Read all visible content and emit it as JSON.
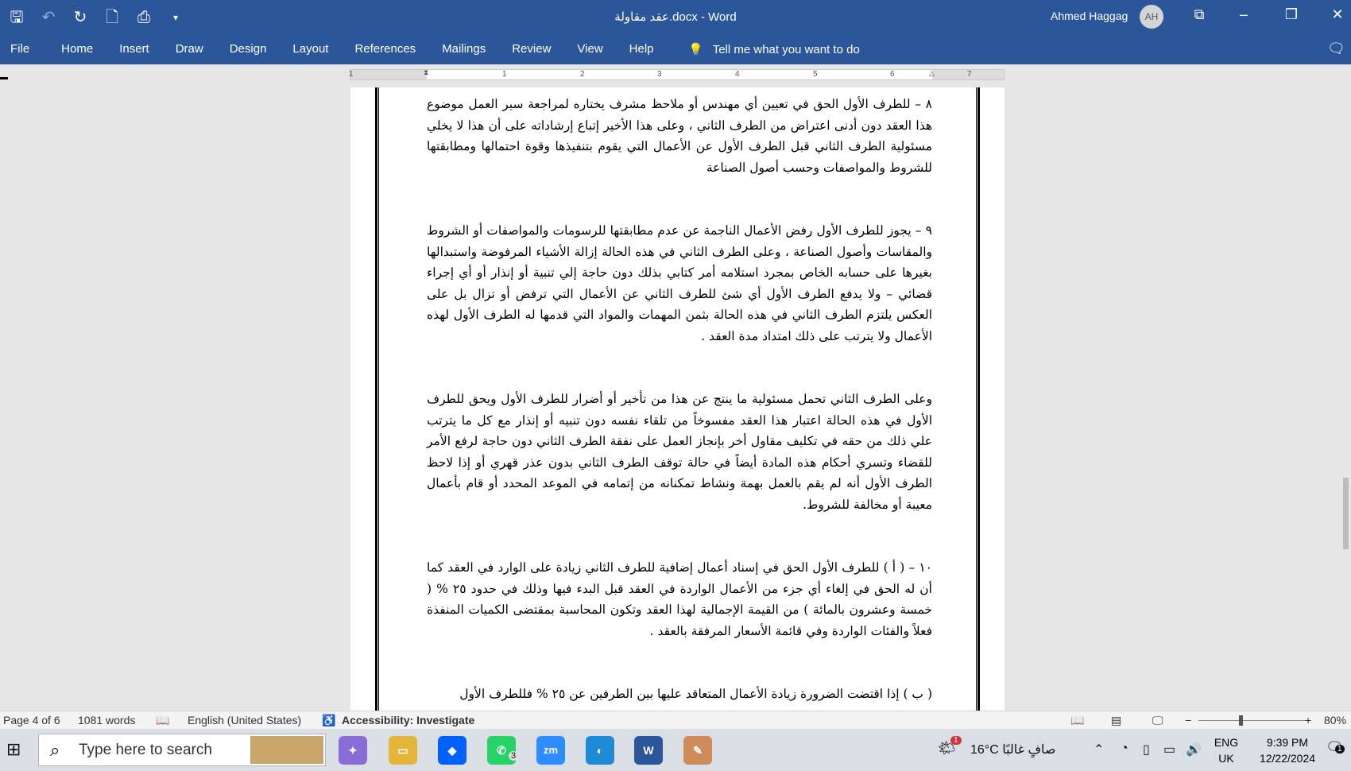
{
  "window": {
    "title": "عقد مقاولة.docx  -  Word",
    "user_name": "Ahmed Haggag",
    "user_initials": "AH"
  },
  "ribbon": {
    "tabs": [
      "File",
      "Home",
      "Insert",
      "Draw",
      "Design",
      "Layout",
      "References",
      "Mailings",
      "Review",
      "View",
      "Help"
    ],
    "tell_me": "Tell me what you want to do"
  },
  "ruler": {
    "numbers": [
      "1",
      "1",
      "2",
      "3",
      "4",
      "5",
      "6",
      "7"
    ]
  },
  "document": {
    "paragraphs": [
      "٨ – للطرف الأول الحق في تعيين أي مهندس أو ملاحظ مشرف يختاره لمراجعة سير العمل موضوع هذا العقد دون أدنى اعتراض من الطرف الثاني ، وعلى هذا الأخير إتباع إرشاداته على أن هذا  لا يخلي مسئولية الطرف الثاني قبل الطرف الأول عن الأعمال التي يقوم بتنفيذها وقوة احتمالها ومطابقتها للشروط والمواصفات وحسب أصول الصناعة",
      "٩ – يجوز للطرف الأول رفض الأعمال الناجمة عن عدم مطابقتها للرسومات والمواصفات أو الشروط والمقاسات وأصول الصناعة ، وعلى الطرف الثاني في هذه الحالة إزالة الأشياء المرفوضة واستبدالها بغيرها على حسابه الخاص بمجرد استلامه أمر كتابي بذلك دون حاجة إلي تنبية أو إنذار أو أي إجراء قضائي – ولا يدفع الطرف الأول أي شئ للطرف الثاني عن الأعمال التي ترفض أو تزال بل على العكس يلتزم الطرف الثاني في هذه الحالة بثمن المهمات والمواد التي قدمها له الطرف الأول لهذه الأعمال ولا يترتب على ذلك امتداد مدة العقد .",
      "وعلى الطرف الثاني تحمل مسئولية ما ينتج عن هذا من تأخير أو أضرار للطرف الأول ويحق للطرف الأول في هذه الحالة اعتبار هذا العقد مفسوخاً من تلقاء نفسه دون تنبيه أو إنذار مع كل ما يترتب علي ذلك من حقه في تكليف مقاول أخر بإنجاز العمل على نفقة الطرف الثاني دون حاجة لرفع الأمر للقضاء وتسري أحكام هذه المادة أيضاً في حالة توقف الطرف الثاني بدون عذر قهري أو إذا لاحظ الطرف الأول أنه لم يقم بالعمل بهمة ونشاط تمكنانه من إتمامه في الموعد المحدد أو قام بأعمال معيبة أو مخالفة للشروط.",
      "١٠ – ( أ ) للطرف الأول الحق في إسناد أعمال إضافية للطرف الثاني زيادة على الوارد في العقد كما أن له الحق في إلغاء أي جزء من الأعمال الواردة في العقد قبل البدء فيها وذلك في حدود ٢٥ % ( خمسة وعشرون بالمائة ) من القيمة الإجمالية لهذا العقد وتكون المحاسبة بمقتضى الكميات المنفذة فعلاً والفئات الواردة وفي قائمة الأسعار المرفقة بالعقد .",
      "( ب )  إذا اقتضت الضرورة زيادة الأعمال المتعاقد عليها بين الطرفين عن ٢٥ % فللطرف الأول"
    ]
  },
  "status": {
    "page": "Page 4 of 6",
    "words": "1081 words",
    "language": "English (United States)",
    "accessibility": "Accessibility: Investigate",
    "zoom": "80%",
    "zoom_level": 0.8
  },
  "taskbar": {
    "search_placeholder": "Type here to search",
    "weather": "16°C  صافٍ غالبًا",
    "lang_top": "ENG",
    "lang_bottom": "UK",
    "time": "9:39 PM",
    "date": "12/22/2024",
    "whatsapp_count": "3",
    "notification_count": "1",
    "weather_badge": "1"
  },
  "colors": {
    "ribbon": "#2b579a",
    "status_bg": "#f3f3f3",
    "taskbar_bg": "#dadfe6"
  }
}
